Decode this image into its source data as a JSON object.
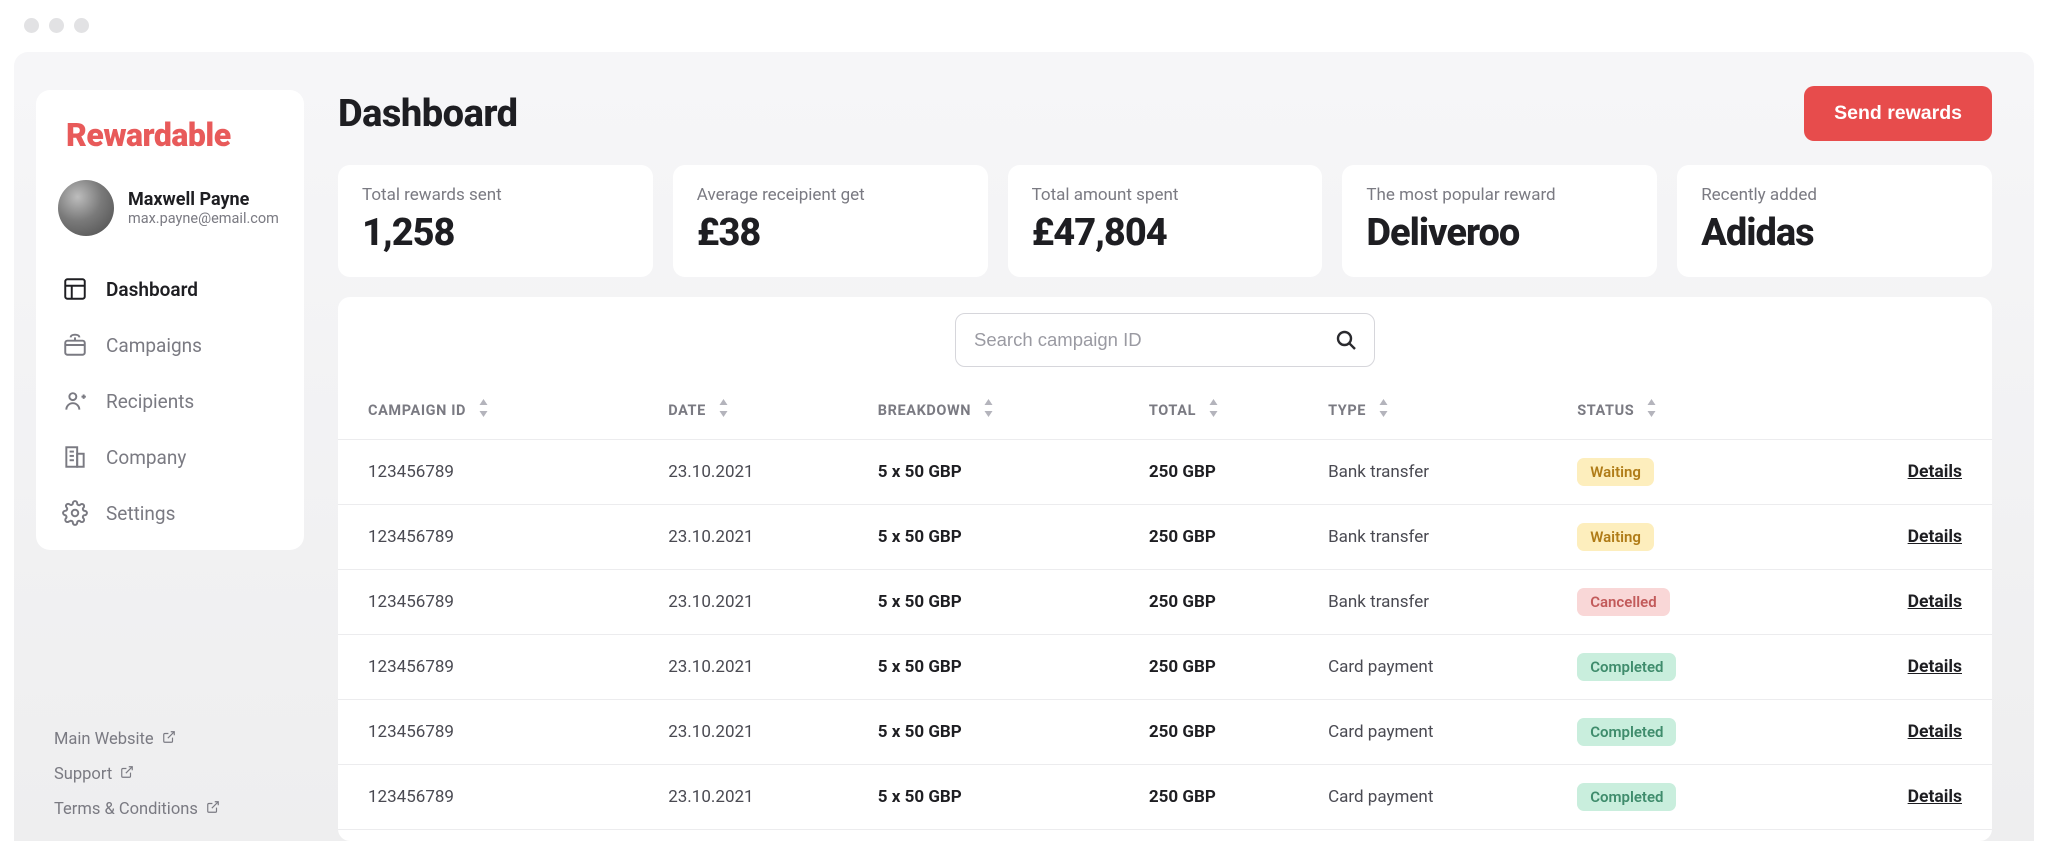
{
  "brand": "Rewardable",
  "user": {
    "name": "Maxwell Payne",
    "email": "max.payne@email.com"
  },
  "nav": {
    "items": [
      {
        "key": "dashboard",
        "label": "Dashboard",
        "active": true
      },
      {
        "key": "campaigns",
        "label": "Campaigns",
        "active": false
      },
      {
        "key": "recipients",
        "label": "Recipients",
        "active": false
      },
      {
        "key": "company",
        "label": "Company",
        "active": false
      },
      {
        "key": "settings",
        "label": "Settings",
        "active": false
      }
    ]
  },
  "footer_links": [
    {
      "label": "Main Website"
    },
    {
      "label": "Support"
    },
    {
      "label": "Terms & Conditions"
    }
  ],
  "header": {
    "title": "Dashboard",
    "send_button": "Send rewards"
  },
  "stats": [
    {
      "label": "Total rewards sent",
      "value": "1,258"
    },
    {
      "label": "Average receipient get",
      "value": "£38"
    },
    {
      "label": "Total amount spent",
      "value": "£47,804"
    },
    {
      "label": "The most popular reward",
      "value": "Deliveroo"
    },
    {
      "label": "Recently added",
      "value": "Adidas"
    }
  ],
  "search": {
    "placeholder": "Search campaign ID"
  },
  "table": {
    "columns": [
      {
        "key": "campaign_id",
        "label": "CAMPAIGN ID",
        "sortable": true
      },
      {
        "key": "date",
        "label": "DATE",
        "sortable": true
      },
      {
        "key": "breakdown",
        "label": "BREAKDOWN",
        "sortable": true
      },
      {
        "key": "total",
        "label": "TOTAL",
        "sortable": true
      },
      {
        "key": "type",
        "label": "TYPE",
        "sortable": true
      },
      {
        "key": "status",
        "label": "STATUS",
        "sortable": true
      },
      {
        "key": "actions",
        "label": "",
        "sortable": false
      }
    ],
    "details_label": "Details",
    "rows": [
      {
        "campaign_id": "123456789",
        "date": "23.10.2021",
        "breakdown": "5 x 50 GBP",
        "total": "250 GBP",
        "type": "Bank transfer",
        "status": "Waiting",
        "status_kind": "waiting"
      },
      {
        "campaign_id": "123456789",
        "date": "23.10.2021",
        "breakdown": "5 x 50 GBP",
        "total": "250 GBP",
        "type": "Bank transfer",
        "status": "Waiting",
        "status_kind": "waiting"
      },
      {
        "campaign_id": "123456789",
        "date": "23.10.2021",
        "breakdown": "5 x 50 GBP",
        "total": "250 GBP",
        "type": "Bank transfer",
        "status": "Cancelled",
        "status_kind": "cancelled"
      },
      {
        "campaign_id": "123456789",
        "date": "23.10.2021",
        "breakdown": "5 x 50 GBP",
        "total": "250 GBP",
        "type": "Card payment",
        "status": "Completed",
        "status_kind": "completed"
      },
      {
        "campaign_id": "123456789",
        "date": "23.10.2021",
        "breakdown": "5 x 50 GBP",
        "total": "250 GBP",
        "type": "Card payment",
        "status": "Completed",
        "status_kind": "completed"
      },
      {
        "campaign_id": "123456789",
        "date": "23.10.2021",
        "breakdown": "5 x 50 GBP",
        "total": "250 GBP",
        "type": "Card payment",
        "status": "Completed",
        "status_kind": "completed"
      }
    ]
  }
}
